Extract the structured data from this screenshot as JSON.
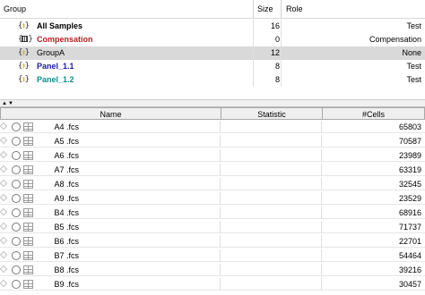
{
  "group_table": {
    "columns": {
      "group": "Group",
      "size": "Size",
      "role": "Role"
    },
    "rows": [
      {
        "name": "All Samples",
        "size": "16",
        "role": "Test",
        "color": "#000000",
        "bold": true,
        "icon": "group-icon"
      },
      {
        "name": "Compensation",
        "size": "0",
        "role": "Compensation",
        "color": "#b22222",
        "bold": true,
        "icon": "compensation-group-icon"
      },
      {
        "name": "GroupA",
        "size": "12",
        "role": "None",
        "color": "#000000",
        "bold": false,
        "icon": "group-icon",
        "selected": true
      },
      {
        "name": "Panel_1.1",
        "size": "8",
        "role": "Test",
        "color": "#1a1aa6",
        "bold": true,
        "icon": "group-icon"
      },
      {
        "name": "Panel_1.2",
        "size": "8",
        "role": "Test",
        "color": "#138a8a",
        "bold": true,
        "icon": "group-icon"
      }
    ]
  },
  "splitter": {
    "icons": [
      "collapse-up-arrow",
      "expand-down-arrow"
    ]
  },
  "sample_table": {
    "columns": {
      "name": "Name",
      "statistic": "Statistic",
      "cells": "#Cells"
    },
    "rows": [
      {
        "name": "A4 .fcs",
        "statistic": "",
        "cells": "65803"
      },
      {
        "name": "A5 .fcs",
        "statistic": "",
        "cells": "70587"
      },
      {
        "name": "A6 .fcs",
        "statistic": "",
        "cells": "23989"
      },
      {
        "name": "A7 .fcs",
        "statistic": "",
        "cells": "63319"
      },
      {
        "name": "A8 .fcs",
        "statistic": "",
        "cells": "32545"
      },
      {
        "name": "A9 .fcs",
        "statistic": "",
        "cells": "23529"
      },
      {
        "name": "B4 .fcs",
        "statistic": "",
        "cells": "68916"
      },
      {
        "name": "B5 .fcs",
        "statistic": "",
        "cells": "71737"
      },
      {
        "name": "B6 .fcs",
        "statistic": "",
        "cells": "22701"
      },
      {
        "name": "B7 .fcs",
        "statistic": "",
        "cells": "54464"
      },
      {
        "name": "B8 .fcs",
        "statistic": "",
        "cells": "39216"
      },
      {
        "name": "B9 .fcs",
        "statistic": "",
        "cells": "30457"
      }
    ]
  }
}
